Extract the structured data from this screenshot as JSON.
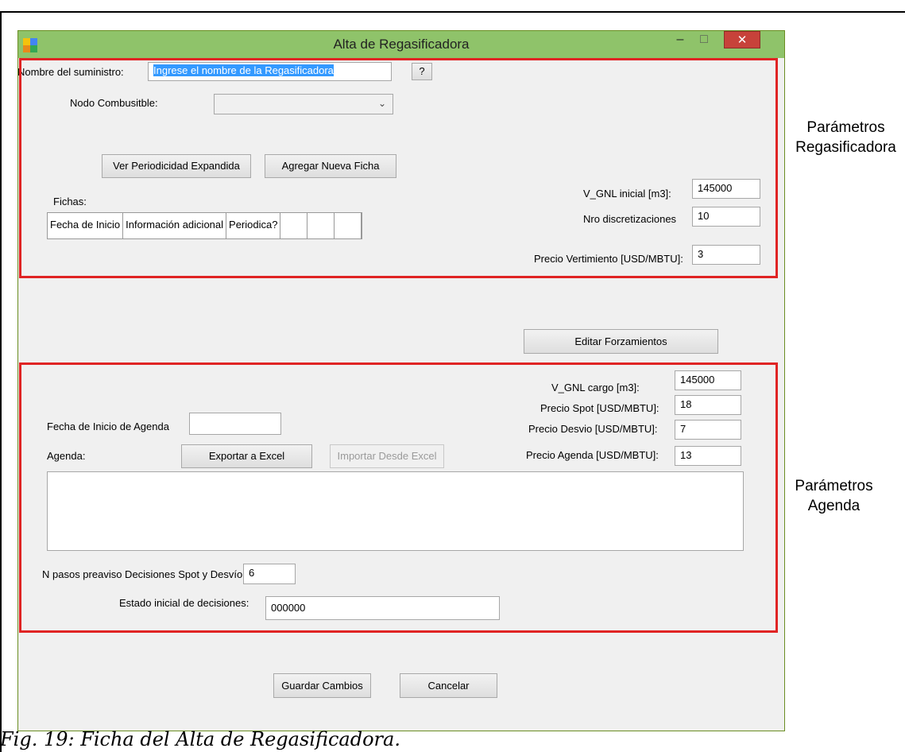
{
  "window": {
    "title": "Alta de Regasificadora",
    "minimize_glyph": "–",
    "maximize_glyph": "□",
    "close_glyph": "✕"
  },
  "supplier": {
    "name_label": "Nombre del suministro:",
    "name_value": "Ingrese el nombre de la Regasificadora",
    "help_label": "?",
    "node_label": "Nodo Combusitble:",
    "node_value": ""
  },
  "buttons": {
    "expand_periodicity": "Ver Periodicidad Expandida",
    "add_card": "Agregar Nueva Ficha",
    "edit_forcings": "Editar Forzamientos",
    "export_excel": "Exportar a Excel",
    "import_excel": "Importar Desde Excel",
    "save": "Guardar Cambios",
    "cancel": "Cancelar"
  },
  "cards": {
    "label": "Fichas:",
    "columns": [
      "Fecha de Inicio",
      "Información adicional",
      "Periodica?",
      "",
      "",
      ""
    ]
  },
  "regas_params": {
    "v_gnl_initial_label": "V_GNL inicial [m3]:",
    "v_gnl_initial_value": "145000",
    "discretizations_label": "Nro discretizaciones",
    "discretizations_value": "10",
    "spill_price_label": "Precio Vertimiento [USD/MBTU]:",
    "spill_price_value": "3"
  },
  "agenda_params": {
    "v_gnl_cargo_label": "V_GNL cargo [m3]:",
    "v_gnl_cargo_value": "145000",
    "spot_price_label": "Precio Spot [USD/MBTU]:",
    "spot_price_value": "18",
    "deviation_price_label": "Precio Desvio [USD/MBTU]:",
    "deviation_price_value": "7",
    "agenda_price_label": "Precio Agenda [USD/MBTU]:",
    "agenda_price_value": "13",
    "start_date_label": "Fecha de Inicio de Agenda",
    "start_date_value": "",
    "agenda_label": "Agenda:",
    "notice_steps_label": "N pasos preaviso Decisiones Spot y Desvío:",
    "notice_steps_value": "6",
    "initial_state_label": "Estado inicial de decisiones:",
    "initial_state_value": "000000"
  },
  "annotations": {
    "regas_line1": "Parámetros",
    "regas_line2": "Regasificadora",
    "agenda_line1": "Parámetros",
    "agenda_line2": "Agenda"
  },
  "caption": "Fig. 19: Ficha del Alta de Regasificadora.",
  "colors": {
    "titlebar": "#8fc36a",
    "highlight_box": "#e02424",
    "close_button": "#c7423a"
  }
}
